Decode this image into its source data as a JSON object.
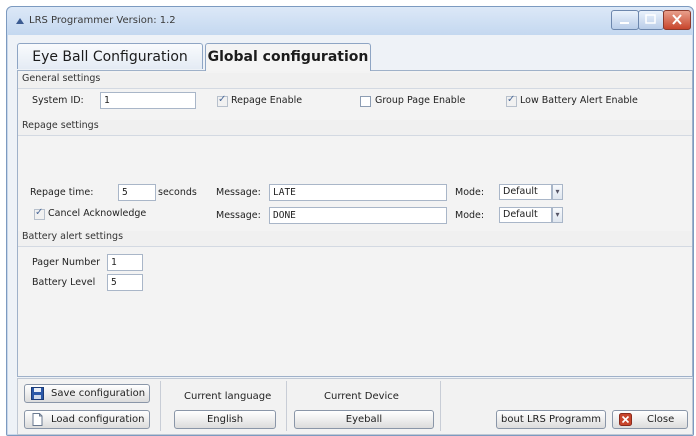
{
  "window": {
    "title": "LRS Programmer   Version: 1.2",
    "controls": {
      "minimize": "minimize-icon",
      "maximize": "maximize-icon",
      "close": "close-icon"
    }
  },
  "tabs": [
    {
      "label": "Eye Ball Configuration",
      "active": false
    },
    {
      "label": "Global configuration",
      "active": true
    }
  ],
  "general": {
    "heading": "General settings",
    "system_id_label": "System ID:",
    "system_id_value": "1",
    "repage_enable_label": "Repage Enable",
    "repage_enable_checked": true,
    "group_page_enable_label": "Group Page Enable",
    "group_page_enable_checked": false,
    "low_battery_label": "Low Battery Alert Enable",
    "low_battery_checked": true
  },
  "repage": {
    "heading": "Repage settings",
    "repage_time_label": "Repage time:",
    "repage_time_value": "5",
    "seconds_label": "seconds",
    "message_label": "Message:",
    "message1_value": "LATE",
    "message2_value": "DONE",
    "mode_label": "Mode:",
    "mode1_value": "Default",
    "mode2_value": "Default",
    "cancel_ack_label": "Cancel Acknowledge",
    "cancel_ack_checked": true
  },
  "battery": {
    "heading": "Battery alert settings",
    "pager_number_label": "Pager Number",
    "pager_number_value": "1",
    "battery_level_label": "Battery Level",
    "battery_level_value": "5"
  },
  "footer": {
    "save_label": "Save configuration",
    "load_label": "Load configuration",
    "current_language_label": "Current language",
    "language_value": "English",
    "current_device_label": "Current Device",
    "device_value": "Eyeball",
    "about_label": "bout LRS Programm",
    "close_label": "Close"
  },
  "colors": {
    "accent": "#7c9ac0",
    "close_red": "#c8452c",
    "save_blue": "#2b58a8"
  }
}
